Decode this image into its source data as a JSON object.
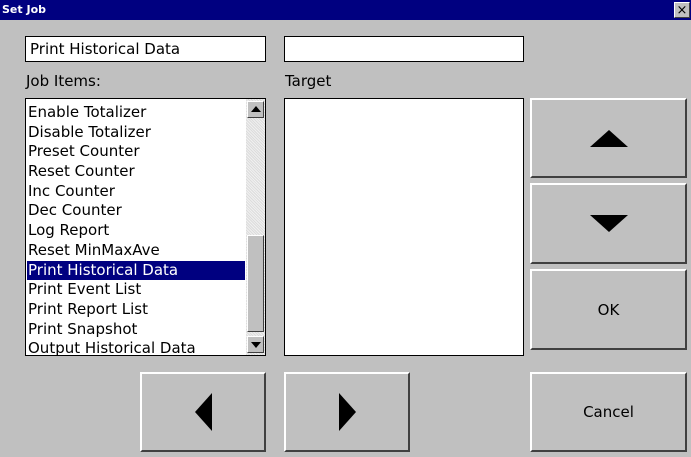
{
  "window": {
    "title": "Set Job",
    "close_label": "×"
  },
  "job_name_field": {
    "value": "Print Historical Data"
  },
  "target_name_field": {
    "value": ""
  },
  "labels": {
    "job_items": "Job Items:",
    "target": "Target"
  },
  "job_items": {
    "items": [
      "Enable Totalizer",
      "Disable Totalizer",
      "Preset Counter",
      "Reset Counter",
      "Inc Counter",
      "Dec Counter",
      "Log Report",
      "Reset MinMaxAve",
      "Print Historical Data",
      "Print Event List",
      "Print Report List",
      "Print Snapshot",
      "Output Historical Data"
    ],
    "selected": "Print Historical Data"
  },
  "buttons": {
    "up_icon": "up-triangle",
    "down_icon": "down-triangle",
    "left_icon": "left-triangle",
    "right_icon": "right-triangle",
    "ok_label": "OK",
    "cancel_label": "Cancel"
  },
  "colors": {
    "title_bar": "#000080",
    "selection": "#000080",
    "face": "#c0c0c0"
  }
}
